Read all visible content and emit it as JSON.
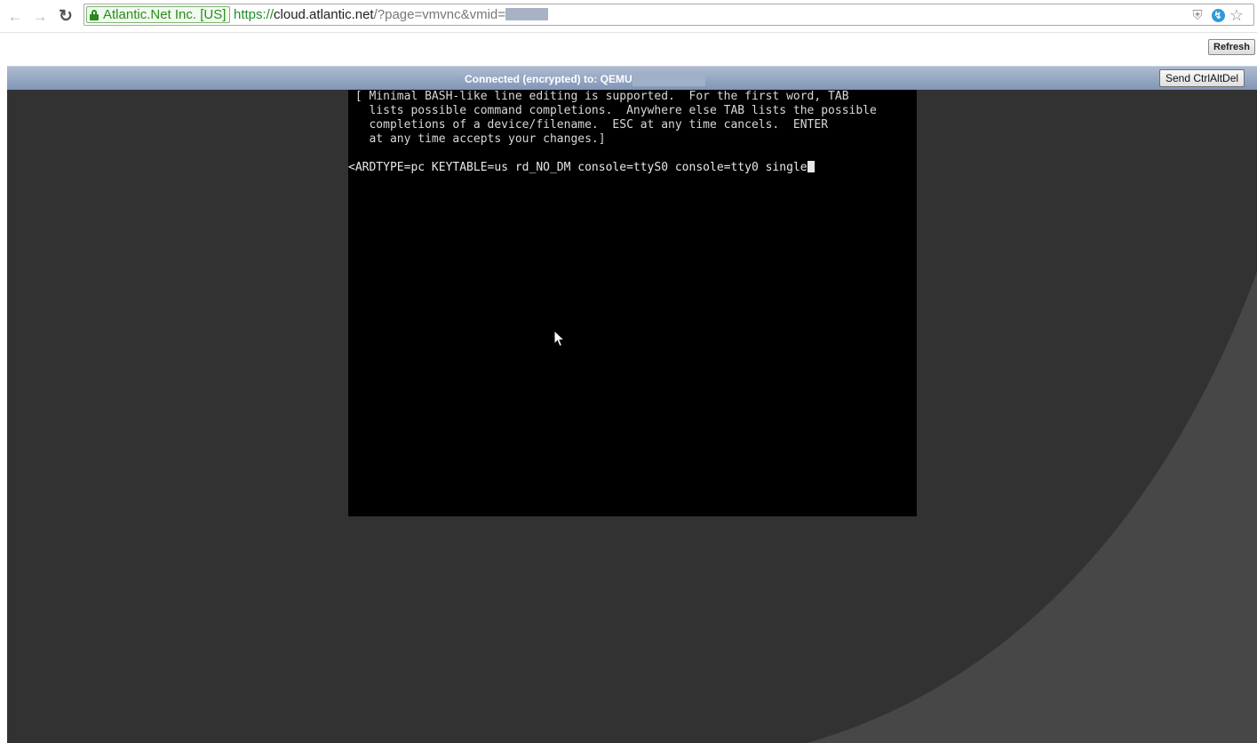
{
  "browser": {
    "nav": {
      "back_icon": "arrow-left",
      "forward_icon": "arrow-right",
      "reload_icon": "reload"
    },
    "ev_badge": "Atlantic.Net Inc. [US]",
    "url": {
      "scheme": "https://",
      "host": "cloud.atlantic.net",
      "path": "/?page=vmvnc&vmid="
    },
    "extension_icons": [
      "shield-icon",
      "bolt-icon",
      "star-icon"
    ]
  },
  "page": {
    "refresh_label": "Refresh"
  },
  "vnc": {
    "status_text": "Connected (encrypted) to: QEMU",
    "send_cad_label": "Send CtrlAltDel",
    "console_help": " [ Minimal BASH-like line editing is supported.  For the first word, TAB\n   lists possible command completions.  Anywhere else TAB lists the possible\n   completions of a device/filename.  ESC at any time cancels.  ENTER\n   at any time accepts your changes.]",
    "command_line": "<ARDTYPE=pc KEYTABLE=us rd_NO_DM console=ttyS0 console=tty0 single",
    "colors": {
      "status_bar": "#8fa2c0",
      "background": "#323232",
      "background_arc": "#474747",
      "console_bg": "#000000",
      "console_fg": "#d8d8d8"
    }
  }
}
